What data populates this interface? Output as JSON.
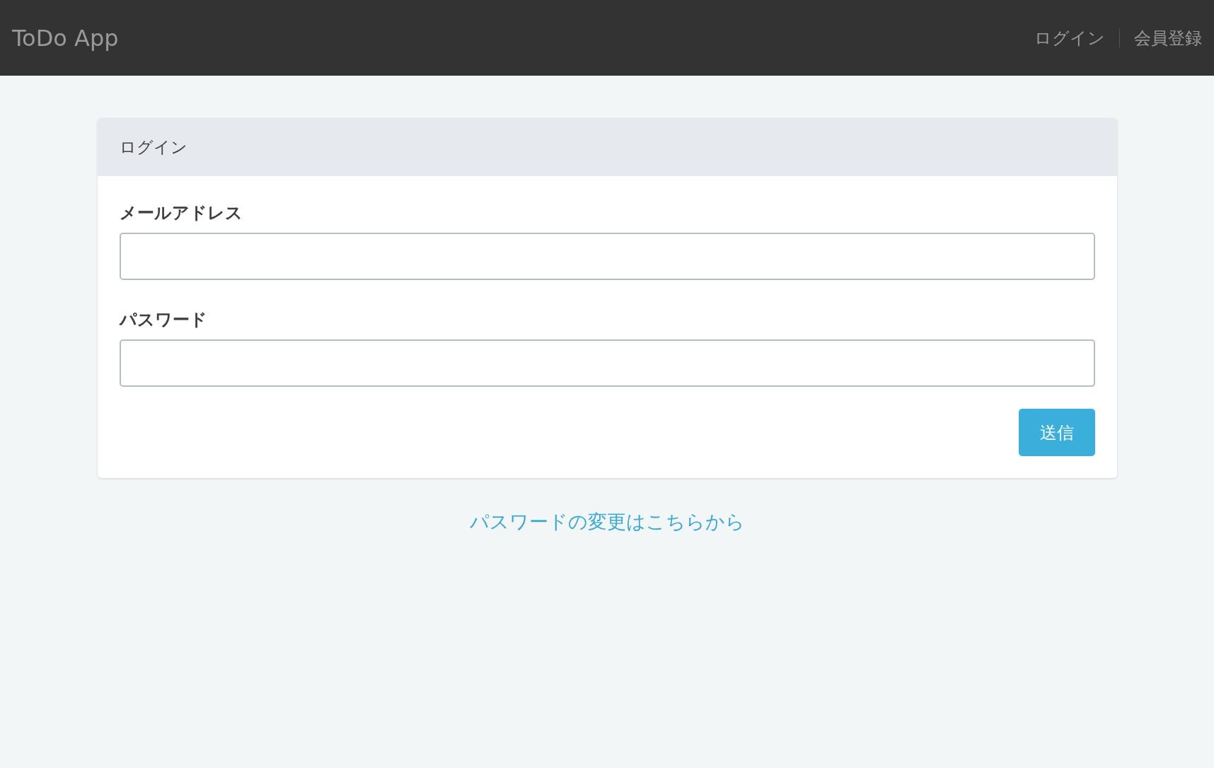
{
  "header": {
    "title": "ToDo App",
    "nav": [
      "ログイン",
      "会員登録"
    ]
  },
  "card": {
    "title": "ログイン",
    "fields": [
      {
        "label": "メールアドレス"
      },
      {
        "label": "パスワード"
      }
    ],
    "submit": "送信"
  },
  "footer_link": "パスワードの変更はこちらから"
}
